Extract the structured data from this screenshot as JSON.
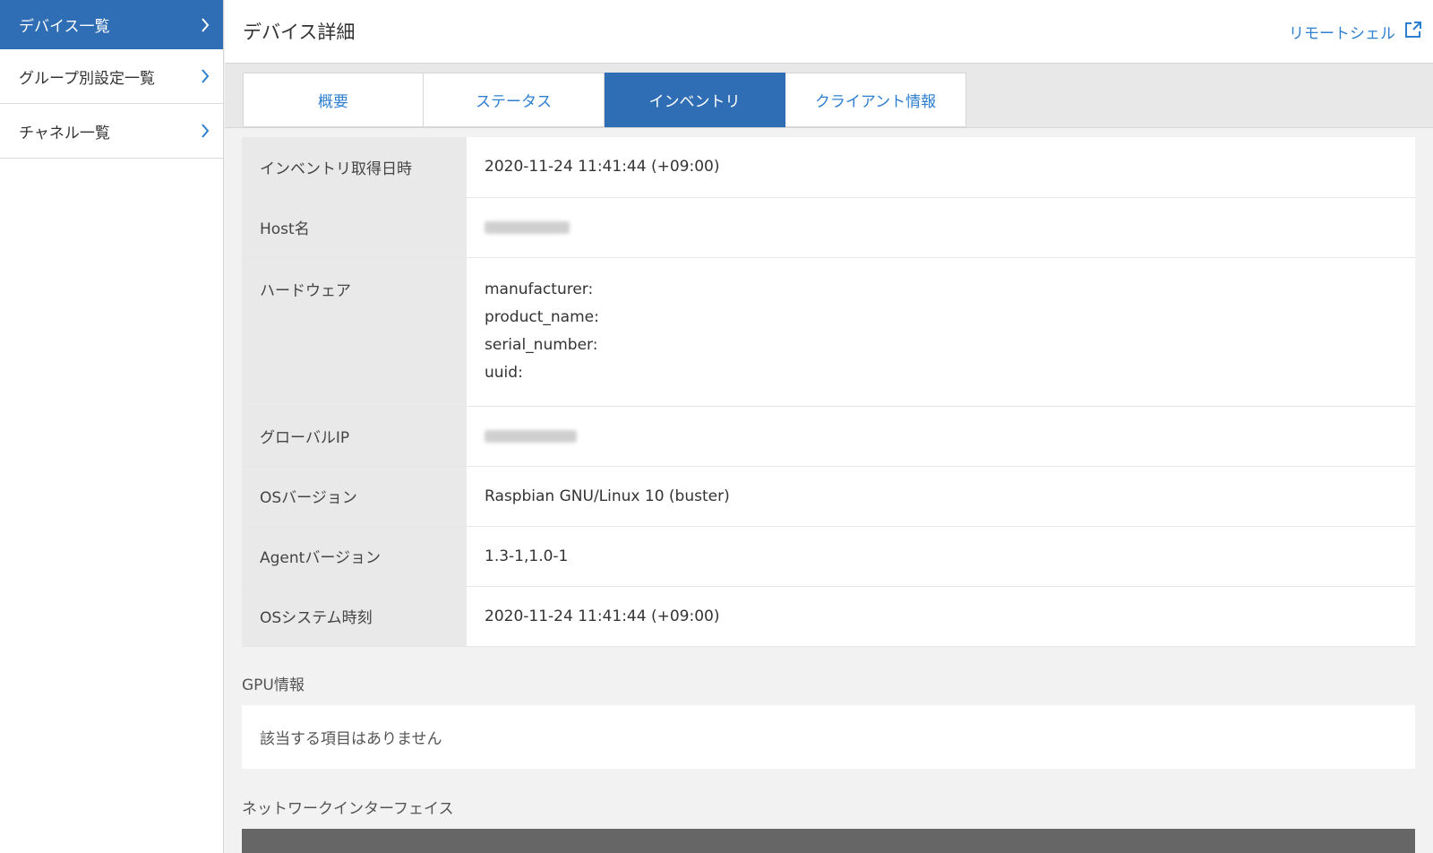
{
  "sidebar": {
    "items": [
      {
        "label": "デバイス一覧"
      },
      {
        "label": "グループ別設定一覧"
      },
      {
        "label": "チャネル一覧"
      }
    ]
  },
  "header": {
    "title": "デバイス詳細",
    "remote_shell": "リモートシェル"
  },
  "tabs": [
    {
      "label": "概要"
    },
    {
      "label": "ステータス"
    },
    {
      "label": "インベントリ"
    },
    {
      "label": "クライアント情報"
    }
  ],
  "inventory": {
    "acquired_label": "インベントリ取得日時",
    "acquired_value": "2020-11-24 11:41:44 (+09:00)",
    "host_label": "Host名",
    "hardware_label": "ハードウェア",
    "hardware_lines": [
      "manufacturer:",
      "product_name:",
      "serial_number:",
      "uuid:"
    ],
    "global_ip_label": "グローバルIP",
    "os_version_label": "OSバージョン",
    "os_version_value": "Raspbian GNU/Linux 10 (buster)",
    "agent_version_label": "Agentバージョン",
    "agent_version_value": "1.3-1,1.0-1",
    "os_time_label": "OSシステム時刻",
    "os_time_value": "2020-11-24 11:41:44 (+09:00)"
  },
  "gpu": {
    "section_title": "GPU情報",
    "empty_text": "該当する項目はありません"
  },
  "network": {
    "section_title": "ネットワークインターフェイス"
  }
}
